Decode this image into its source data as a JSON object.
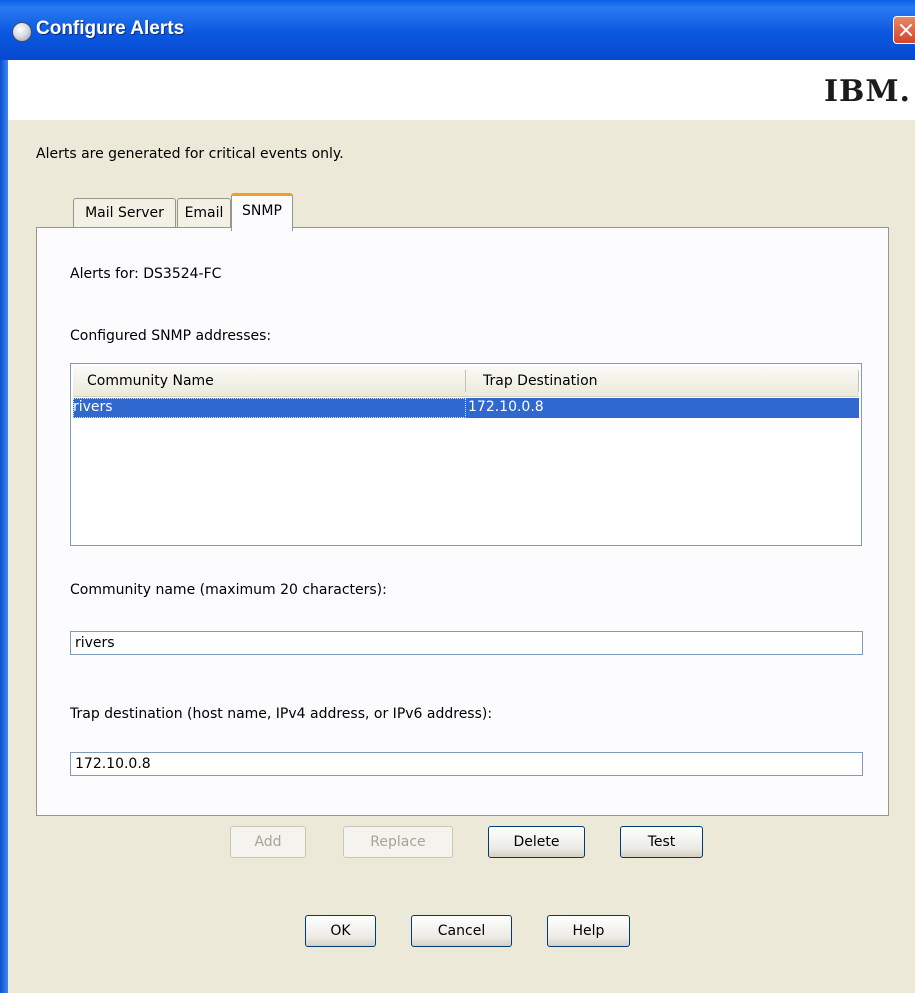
{
  "window": {
    "title": "Configure Alerts",
    "icon": "globe-icon",
    "close_icon": "close-icon"
  },
  "banner": {
    "logo": "IBM."
  },
  "intro_text": "Alerts are generated for critical events only.",
  "tabs": [
    {
      "label": "Mail Server",
      "active": false
    },
    {
      "label": "Email",
      "active": false
    },
    {
      "label": "SNMP",
      "active": true
    }
  ],
  "snmp": {
    "alerts_for_label": "Alerts for: DS3524-FC",
    "configured_label": "Configured SNMP addresses:",
    "table": {
      "columns": [
        "Community Name",
        "Trap Destination"
      ],
      "rows": [
        {
          "community": "rivers",
          "destination": "172.10.0.8",
          "selected": true
        }
      ]
    },
    "community_label": "Community name (maximum 20 characters):",
    "community_value": "rivers",
    "trap_label": "Trap destination (host name, IPv4 address, or IPv6 address):",
    "trap_value": "172.10.0.8",
    "buttons": {
      "add": "Add",
      "replace": "Replace",
      "delete": "Delete",
      "test": "Test"
    }
  },
  "footer": {
    "ok": "OK",
    "cancel": "Cancel",
    "help": "Help"
  },
  "colors": {
    "title_bar": "#0a5ee8",
    "selection": "#2f68cf",
    "active_tab_accent": "#f0a11e",
    "dialog_bg": "#ece9d8"
  }
}
